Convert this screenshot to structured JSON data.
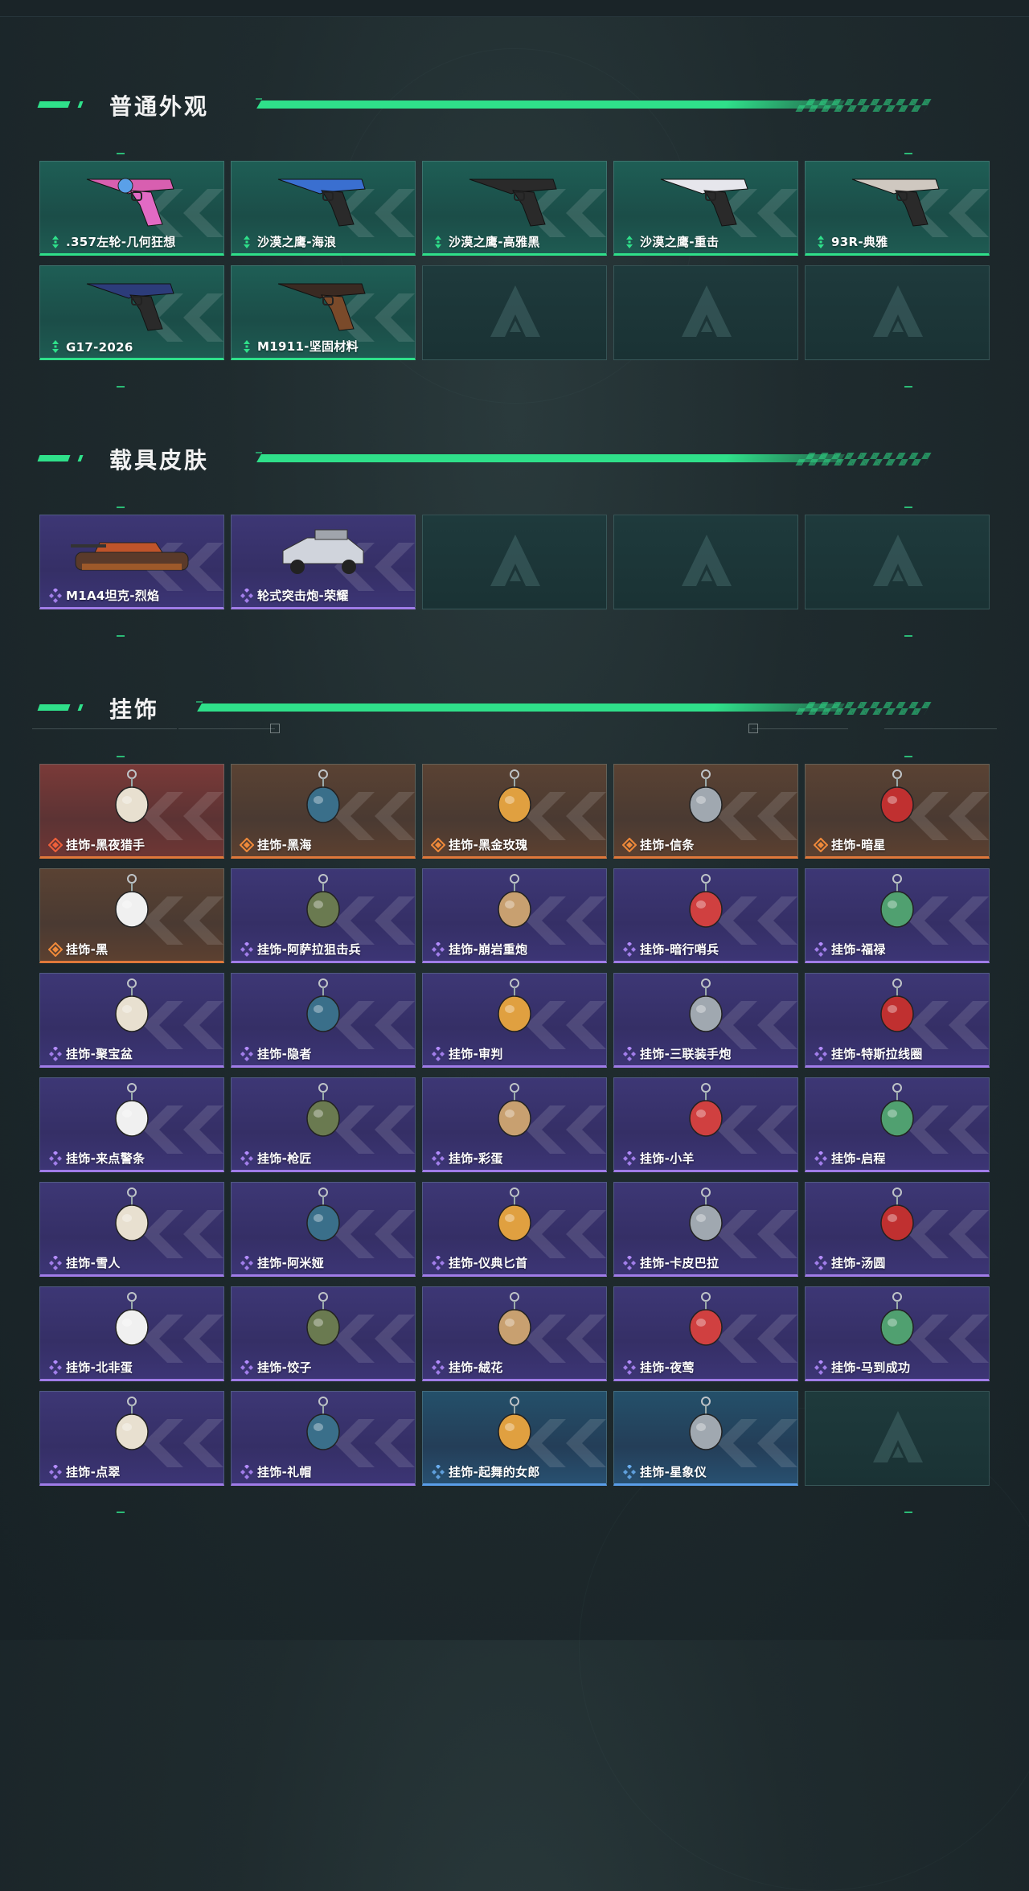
{
  "colors": {
    "accent": "#2fe08a",
    "green_tile": "#1e5e55",
    "purple_tile": "#3d3775",
    "orange_tile": "#5a4233",
    "red_tile": "#7a3a38",
    "blue_tile": "#24506a",
    "empty_tile": "#1e3a3c"
  },
  "sections": [
    {
      "title": "普通外观",
      "items": [
        {
          "label": ".357左轮-几何狂想",
          "rarity": "green",
          "icon": "revolver-icon"
        },
        {
          "label": "沙漠之鹰-海浪",
          "rarity": "green",
          "icon": "pistol-icon"
        },
        {
          "label": "沙漠之鹰-高雅黑",
          "rarity": "green",
          "icon": "pistol-icon"
        },
        {
          "label": "沙漠之鹰-重击",
          "rarity": "green",
          "icon": "pistol-icon"
        },
        {
          "label": "93R-典雅",
          "rarity": "green",
          "icon": "pistol-icon"
        },
        {
          "label": "G17-2026",
          "rarity": "green",
          "icon": "pistol-icon"
        },
        {
          "label": "M1911-坚固材料",
          "rarity": "green",
          "icon": "pistol-icon"
        }
      ]
    },
    {
      "title": "载具皮肤",
      "items": [
        {
          "label": "M1A4坦克-烈焰",
          "rarity": "purple",
          "icon": "tank-icon"
        },
        {
          "label": "轮式突击炮-荣耀",
          "rarity": "purple",
          "icon": "vehicle-icon"
        }
      ]
    },
    {
      "title": "挂饰",
      "items": [
        {
          "label": "挂饰-黑夜猎手",
          "rarity": "red",
          "icon": "charm-icon"
        },
        {
          "label": "挂饰-黑海",
          "rarity": "orange",
          "icon": "charm-icon"
        },
        {
          "label": "挂饰-黑金玫瑰",
          "rarity": "orange",
          "icon": "charm-icon"
        },
        {
          "label": "挂饰-信条",
          "rarity": "orange",
          "icon": "charm-icon"
        },
        {
          "label": "挂饰-暗星",
          "rarity": "orange",
          "icon": "charm-icon"
        },
        {
          "label": "挂饰-黑",
          "rarity": "orange",
          "icon": "charm-icon"
        },
        {
          "label": "挂饰-阿萨拉狙击兵",
          "rarity": "purple",
          "icon": "charm-icon"
        },
        {
          "label": "挂饰-崩岩重炮",
          "rarity": "purple",
          "icon": "charm-icon"
        },
        {
          "label": "挂饰-暗行哨兵",
          "rarity": "purple",
          "icon": "charm-icon"
        },
        {
          "label": "挂饰-福禄",
          "rarity": "purple",
          "icon": "charm-icon"
        },
        {
          "label": "挂饰-聚宝盆",
          "rarity": "purple",
          "icon": "charm-icon"
        },
        {
          "label": "挂饰-隐者",
          "rarity": "purple",
          "icon": "charm-icon"
        },
        {
          "label": "挂饰-审判",
          "rarity": "purple",
          "icon": "charm-icon"
        },
        {
          "label": "挂饰-三联装手炮",
          "rarity": "purple",
          "icon": "charm-icon"
        },
        {
          "label": "挂饰-特斯拉线圈",
          "rarity": "purple",
          "icon": "charm-icon"
        },
        {
          "label": "挂饰-来点警条",
          "rarity": "purple",
          "icon": "charm-icon"
        },
        {
          "label": "挂饰-枪匠",
          "rarity": "purple",
          "icon": "charm-icon"
        },
        {
          "label": "挂饰-彩蛋",
          "rarity": "purple",
          "icon": "charm-icon"
        },
        {
          "label": "挂饰-小羊",
          "rarity": "purple",
          "icon": "charm-icon"
        },
        {
          "label": "挂饰-启程",
          "rarity": "purple",
          "icon": "charm-icon"
        },
        {
          "label": "挂饰-雪人",
          "rarity": "purple",
          "icon": "charm-icon"
        },
        {
          "label": "挂饰-阿米娅",
          "rarity": "purple",
          "icon": "charm-icon"
        },
        {
          "label": "挂饰-仪典匕首",
          "rarity": "purple",
          "icon": "charm-icon"
        },
        {
          "label": "挂饰-卡皮巴拉",
          "rarity": "purple",
          "icon": "charm-icon"
        },
        {
          "label": "挂饰-汤圆",
          "rarity": "purple",
          "icon": "charm-icon"
        },
        {
          "label": "挂饰-北非蛋",
          "rarity": "purple",
          "icon": "charm-icon"
        },
        {
          "label": "挂饰-饺子",
          "rarity": "purple",
          "icon": "charm-icon"
        },
        {
          "label": "挂饰-絨花",
          "rarity": "purple",
          "icon": "charm-icon"
        },
        {
          "label": "挂饰-夜莺",
          "rarity": "purple",
          "icon": "charm-icon"
        },
        {
          "label": "挂饰-马到成功",
          "rarity": "purple",
          "icon": "charm-icon"
        },
        {
          "label": "挂饰-点翠",
          "rarity": "purple",
          "icon": "charm-icon"
        },
        {
          "label": "挂饰-礼帽",
          "rarity": "purple",
          "icon": "charm-icon"
        },
        {
          "label": "挂饰-起舞的女郎",
          "rarity": "blue",
          "icon": "charm-icon"
        },
        {
          "label": "挂饰-星象仪",
          "rarity": "blue",
          "icon": "charm-icon"
        }
      ]
    }
  ]
}
